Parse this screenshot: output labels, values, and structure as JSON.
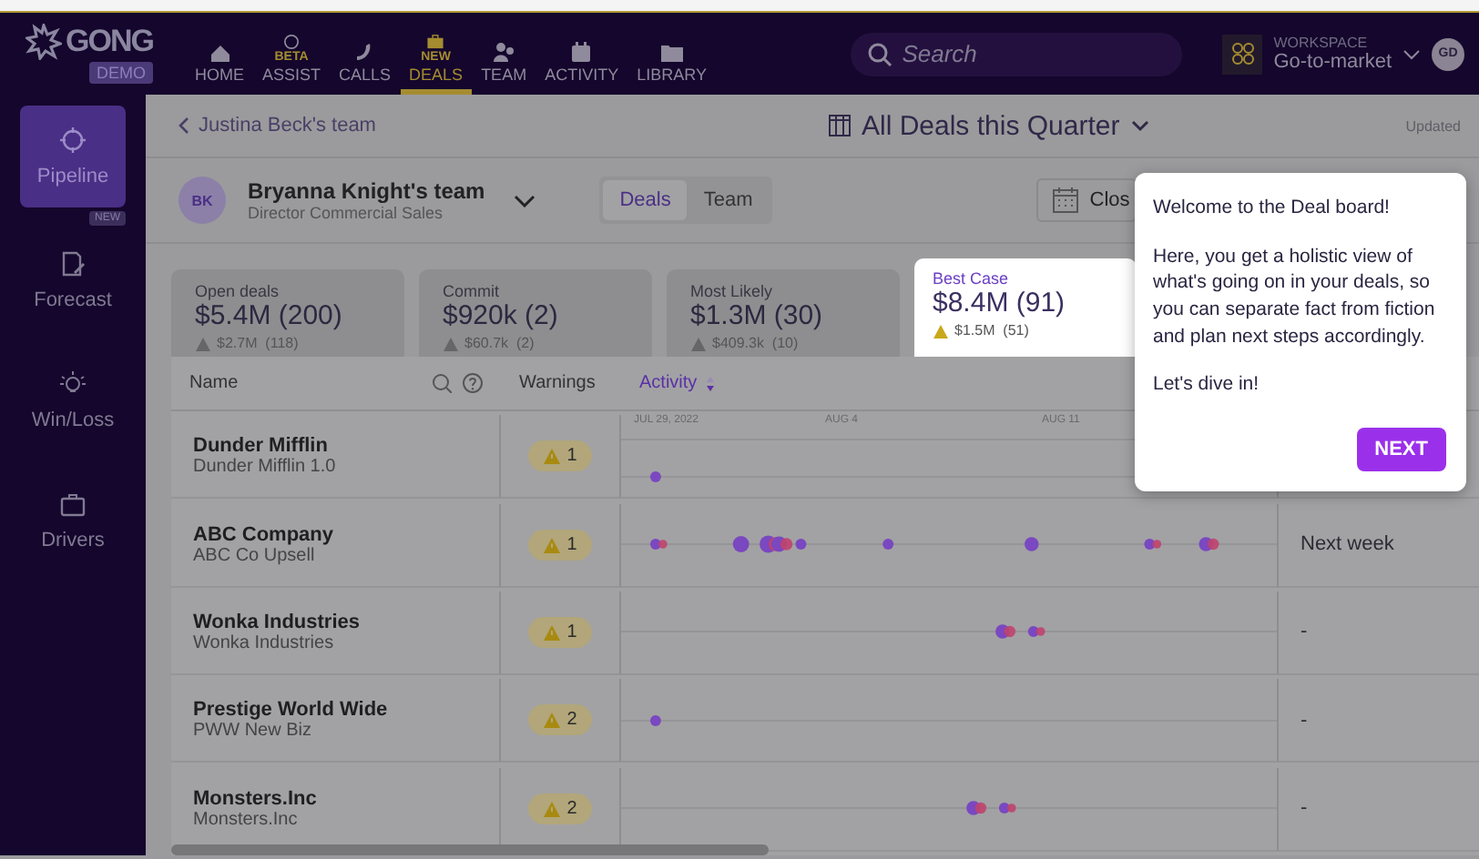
{
  "topbar": {
    "logo": "GONG",
    "logo_badge": "DEMO",
    "nav": [
      {
        "label": "HOME",
        "selected": false
      },
      {
        "label": "ASSIST",
        "badge": "BETA",
        "selected": false
      },
      {
        "label": "CALLS",
        "selected": false
      },
      {
        "label": "DEALS",
        "badge": "NEW",
        "selected": true
      },
      {
        "label": "TEAM",
        "selected": false
      },
      {
        "label": "ACTIVITY",
        "selected": false
      },
      {
        "label": "LIBRARY",
        "selected": false
      }
    ],
    "search": {
      "placeholder": "Search"
    },
    "workspace": {
      "label": "WORKSPACE",
      "value": "Go-to-market"
    },
    "avatar": "GD"
  },
  "sidebar": {
    "items": [
      {
        "label": "Pipeline",
        "selected": true
      },
      {
        "label": "Forecast",
        "badge": "NEW",
        "selected": false
      },
      {
        "label": "Win/Loss",
        "selected": false
      },
      {
        "label": "Drivers",
        "selected": false
      }
    ]
  },
  "header": {
    "breadcrumb": "Justina Beck's team",
    "view_title": "All Deals this Quarter",
    "updated": "Updated"
  },
  "team": {
    "initials": "BK",
    "name": "Bryanna Knight's team",
    "role": "Director Commercial Sales",
    "tabs": [
      {
        "label": "Deals",
        "selected": true
      },
      {
        "label": "Team",
        "selected": false
      }
    ],
    "date_button": "Clos"
  },
  "cards": [
    {
      "label": "Open deals",
      "value": "$5.4M (200)",
      "warning": "$2.7M  (118)",
      "highlighted": false
    },
    {
      "label": "Commit",
      "value": "$920k (2)",
      "warning": "$60.7k  (2)",
      "highlighted": false
    },
    {
      "label": "Most Likely",
      "value": "$1.3M (30)",
      "warning": "$409.3k  (10)",
      "highlighted": false
    },
    {
      "label": "Best Case",
      "value": "$8.4M (91)",
      "warning": "$1.5M  (51)",
      "highlighted": true
    }
  ],
  "table": {
    "columns": [
      {
        "label": "Name"
      },
      {
        "label": "Warnings"
      },
      {
        "label": "Activity",
        "sorted": true
      }
    ],
    "timeline_labels": [
      "JUL 29, 2022",
      "AUG 4",
      "AUG 11"
    ],
    "rows": [
      {
        "name": "Dunder Mifflin",
        "subtitle": "Dunder Mifflin 1.0",
        "warnings": "1"
      },
      {
        "name": "ABC Company",
        "subtitle": "ABC Co Upsell",
        "warnings": "1",
        "next_step": "Next week"
      },
      {
        "name": "Wonka Industries",
        "subtitle": "Wonka Industries",
        "warnings": "1",
        "next_step": "-"
      },
      {
        "name": "Prestige World Wide",
        "subtitle": "PWW New Biz",
        "warnings": "2",
        "next_step": "-"
      },
      {
        "name": "Monsters.Inc",
        "subtitle": "Monsters.Inc",
        "warnings": "2",
        "next_step": "-"
      }
    ]
  },
  "tooltip": {
    "title": "Welcome to the Deal board!",
    "body": "Here, you get a holistic view of what's going on in your deals, so you can separate fact from fiction and plan next steps accordingly.",
    "closing": "Let's dive in!",
    "button": "NEXT"
  }
}
